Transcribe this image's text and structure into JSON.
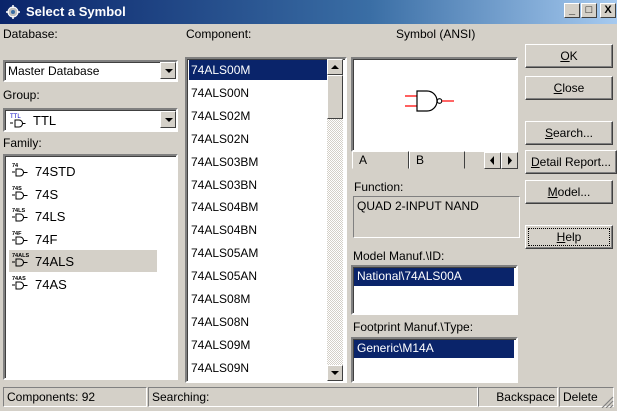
{
  "window": {
    "title": "Select a Symbol",
    "minimize": "_",
    "maximize": "□",
    "close": "X"
  },
  "database": {
    "label": "Database:",
    "value": "Master Database"
  },
  "group": {
    "label": "Group:",
    "value": "TTL",
    "icon_text": "TTL"
  },
  "family": {
    "label": "Family:",
    "items": [
      {
        "label": "74STD",
        "icon_text": "74"
      },
      {
        "label": "74S",
        "icon_text": "74S"
      },
      {
        "label": "74LS",
        "icon_text": "74LS"
      },
      {
        "label": "74F",
        "icon_text": "74F"
      },
      {
        "label": "74ALS",
        "icon_text": "74ALS"
      },
      {
        "label": "74AS",
        "icon_text": "74AS"
      }
    ],
    "selected": "74ALS"
  },
  "component": {
    "label": "Component:",
    "items": [
      "74ALS00M",
      "74ALS00N",
      "74ALS02M",
      "74ALS02N",
      "74ALS03BM",
      "74ALS03BN",
      "74ALS04BM",
      "74ALS04BN",
      "74ALS05AM",
      "74ALS05AN",
      "74ALS08M",
      "74ALS08N",
      "74ALS09M",
      "74ALS09N"
    ],
    "selected": "74ALS00M"
  },
  "symbol": {
    "label": "Symbol (ANSI)",
    "tabs": [
      "A",
      "B"
    ]
  },
  "function": {
    "label": "Function:",
    "value": "QUAD 2-INPUT NAND"
  },
  "model_manuf": {
    "label": "Model Manuf.\\ID:",
    "value": "National\\74ALS00A"
  },
  "footprint": {
    "label": "Footprint Manuf.\\Type:",
    "value": "Generic\\M14A"
  },
  "buttons": {
    "ok": {
      "u": "O",
      "rest": "K"
    },
    "close": {
      "u": "C",
      "rest": "lose"
    },
    "search": {
      "u": "S",
      "rest": "earch..."
    },
    "detail": {
      "u": "D",
      "rest": "etail Report..."
    },
    "model": {
      "u": "M",
      "rest": "odel..."
    },
    "help": {
      "u": "H",
      "rest": "elp"
    }
  },
  "status": {
    "components": "Components: 92",
    "searching": "Searching:",
    "backspace": "Backspace",
    "delete": "Delete"
  },
  "colors": {
    "selection": "#0a246a",
    "face": "#d4d0c8",
    "gate_red": "#ff0000"
  }
}
